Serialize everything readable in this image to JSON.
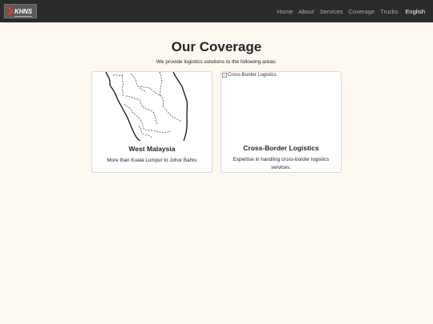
{
  "nav": {
    "brand_text": "KHNS",
    "links": [
      "Home",
      "About",
      "Services",
      "Coverage",
      "Trucks"
    ],
    "language": "English"
  },
  "page": {
    "title": "Our Coverage",
    "subtitle": "We provide logistics solutions to the following areas:"
  },
  "cards": [
    {
      "image_icon": "map-of-west-malaysia",
      "title": "West Malaysia",
      "text": "More than Kuala Lumpur to Johor Bahru"
    },
    {
      "image_alt": "Cross-Border Logistics",
      "title": "Cross-Border Logistics",
      "text": "Expertise in handling cross-border logistics services."
    }
  ],
  "colors": {
    "navbar": "#2b2b2b",
    "page_background": "#fdf9f1",
    "card_background": "#ffffff",
    "brand_accent": "#e63b2e"
  }
}
